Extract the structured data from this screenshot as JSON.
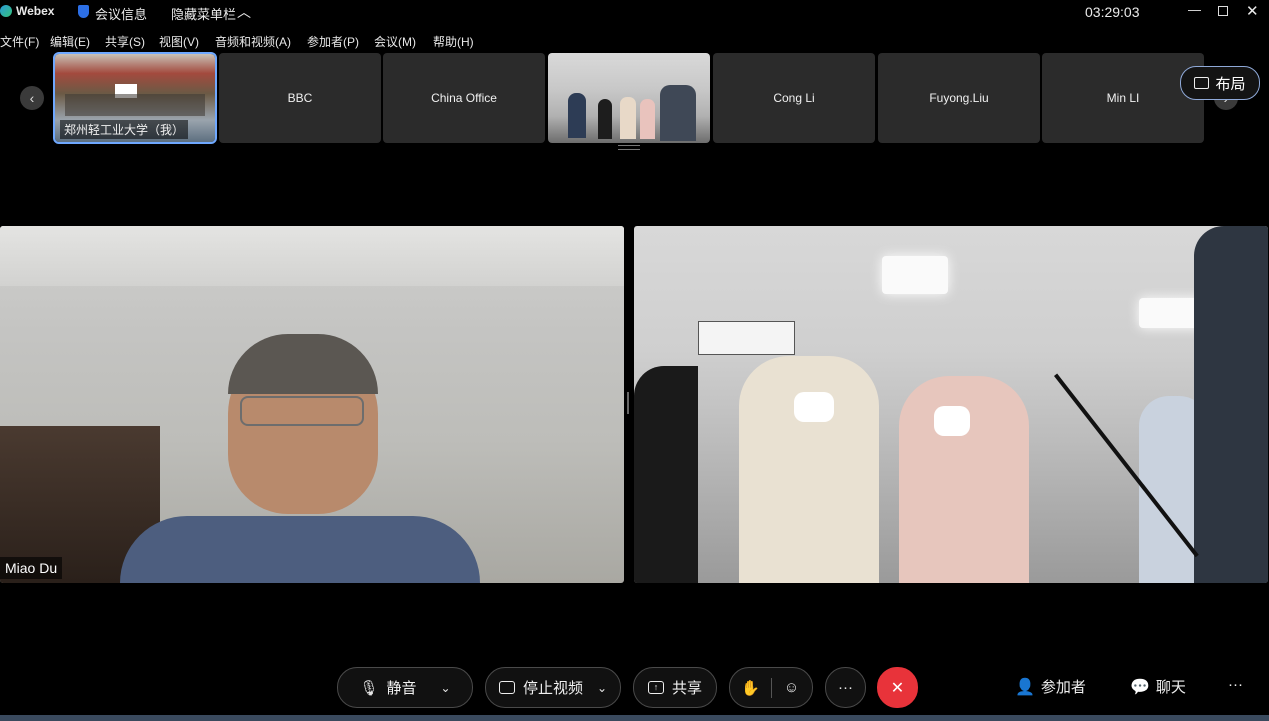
{
  "titlebar": {
    "app_name": "Webex",
    "meeting_info": "会议信息",
    "hide_menu": "隐藏菜单栏",
    "clock": "03:29:03"
  },
  "menu": [
    "文件(F)",
    "编辑(E)",
    "共享(S)",
    "视图(V)",
    "音频和视频(A)",
    "参加者(P)",
    "会议(M)",
    "帮助(H)"
  ],
  "thumbnails": [
    {
      "label": "郑州轻工业大学（我）",
      "kind": "video"
    },
    {
      "label": "BBC",
      "kind": "name"
    },
    {
      "label": "China Office",
      "kind": "name"
    },
    {
      "label": "",
      "kind": "video"
    },
    {
      "label": "Cong Li",
      "kind": "name"
    },
    {
      "label": "Fuyong.Liu",
      "kind": "name"
    },
    {
      "label": "Min LI",
      "kind": "name"
    }
  ],
  "layout_button": "布局",
  "videos": [
    {
      "label": "Miao Du"
    },
    {
      "label": ""
    }
  ],
  "controls": {
    "mute": "静音",
    "stop_video": "停止视频",
    "share": "共享",
    "participants": "参加者",
    "chat": "聊天",
    "more": "···"
  },
  "colors": {
    "accent": "#6fa8ff",
    "end_call": "#e8333a",
    "thumb_bg": "#2b2b2b"
  }
}
